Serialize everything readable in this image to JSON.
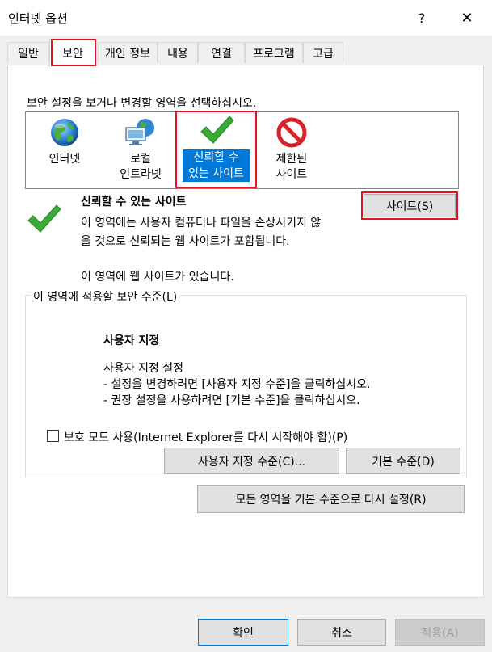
{
  "window": {
    "title": "인터넷 옵션",
    "help_glyph": "?",
    "close_glyph": "✕"
  },
  "tabs": [
    {
      "label": "일반"
    },
    {
      "label": "보안",
      "active": true
    },
    {
      "label": "개인 정보"
    },
    {
      "label": "내용"
    },
    {
      "label": "연결"
    },
    {
      "label": "프로그램"
    },
    {
      "label": "고급"
    }
  ],
  "security": {
    "zone_prompt": "보안 설정을 보거나 변경할 영역을 선택하십시오.",
    "zones": [
      {
        "line1": "인터넷",
        "line2": "",
        "icon": "globe-icon"
      },
      {
        "line1": "로컬",
        "line2": "인트라넷",
        "icon": "intranet-icon"
      },
      {
        "line1": "신뢰할 수",
        "line2": "있는 사이트",
        "icon": "checkmark-icon",
        "selected": true
      },
      {
        "line1": "제한된",
        "line2": "사이트",
        "icon": "prohibited-icon"
      }
    ],
    "selected_zone": {
      "title": "신뢰할 수 있는 사이트",
      "desc1": "이 영역에는 사용자 컴퓨터나 파일을 손상시키지 않",
      "desc2": "을 것으로 신뢰되는 웹 사이트가 포함됩니다.",
      "sites_note": "이 영역에 웹 사이트가 있습니다.",
      "sites_button": "사이트(S)"
    },
    "level_group": {
      "title": "이 영역에 적용할 보안 수준(L)",
      "level_name": "사용자 지정",
      "level_desc": "사용자 지정 설정",
      "bullet1": "- 설정을 변경하려면 [사용자 지정 수준]을 클릭하십시오.",
      "bullet2": "- 권장 설정을 사용하려면 [기본 수준]을 클릭하십시오.",
      "protected_mode_label": "보호 모드 사용(Internet Explorer를 다시 시작해야 함)(P)",
      "protected_mode_checked": false,
      "custom_level_button": "사용자 지정 수준(C)...",
      "default_level_button": "기본 수준(D)"
    },
    "reset_all_button": "모든 영역을 기본 수준으로 다시 설정(R)"
  },
  "footer": {
    "ok": "확인",
    "cancel": "취소",
    "apply": "적용(A)"
  },
  "colors": {
    "accent": "#0078d7",
    "highlight_frame": "#e81123",
    "check_green": "#3aaa35"
  }
}
